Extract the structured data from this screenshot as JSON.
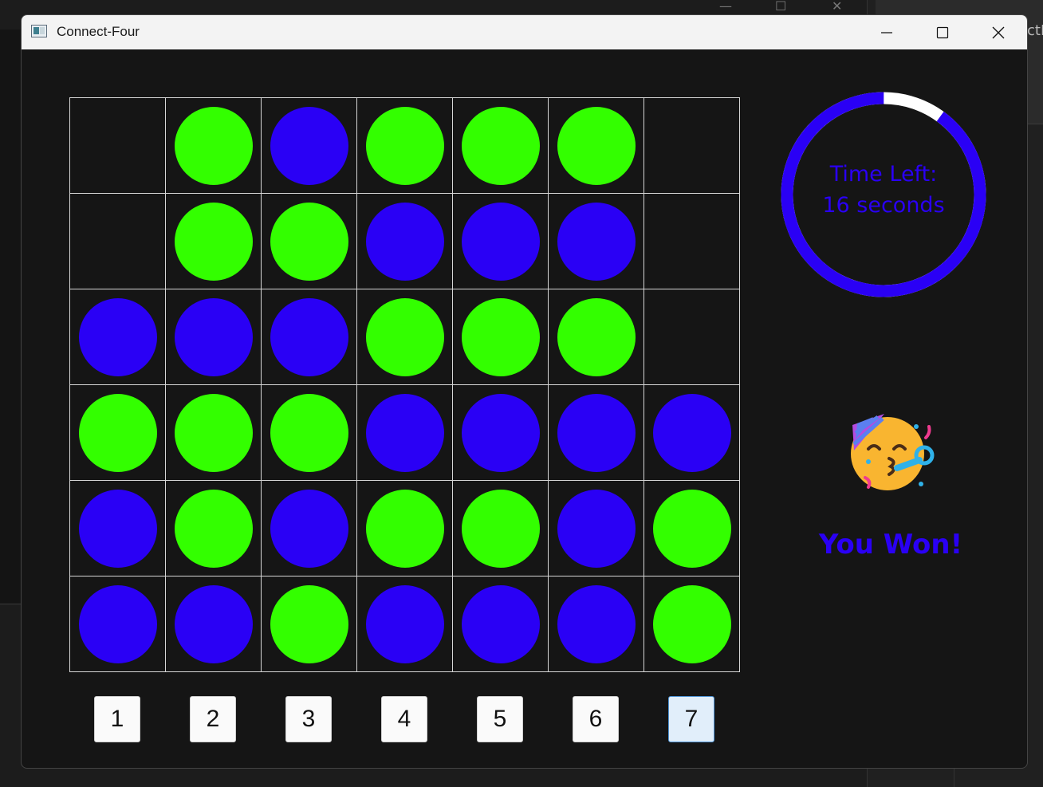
{
  "window": {
    "title": "Connect-Four",
    "icon": "app-window-icon"
  },
  "background": {
    "right_tab_text": "ctF"
  },
  "colors": {
    "green": "#33ff00",
    "blue": "#2a00f5",
    "timer_track": "#ffffff",
    "board_lines": "#d6d6d6",
    "background": "#151515"
  },
  "board": {
    "rows": [
      [
        "empty",
        "green",
        "blue",
        "green",
        "green",
        "green",
        "empty"
      ],
      [
        "empty",
        "green",
        "green",
        "blue",
        "blue",
        "blue",
        "empty"
      ],
      [
        "blue",
        "blue",
        "blue",
        "green",
        "green",
        "green",
        "empty"
      ],
      [
        "green",
        "green",
        "green",
        "blue",
        "blue",
        "blue",
        "blue"
      ],
      [
        "blue",
        "green",
        "blue",
        "green",
        "green",
        "blue",
        "green"
      ],
      [
        "blue",
        "blue",
        "green",
        "blue",
        "blue",
        "blue",
        "green"
      ]
    ]
  },
  "columns": {
    "labels": [
      "1",
      "2",
      "3",
      "4",
      "5",
      "6",
      "7"
    ],
    "highlighted": "7"
  },
  "timer": {
    "line1": "Time Left:",
    "line2": "16 seconds",
    "remaining_fraction": 0.9
  },
  "result": {
    "emoji": "partying-face-icon",
    "message": "You Won!"
  }
}
